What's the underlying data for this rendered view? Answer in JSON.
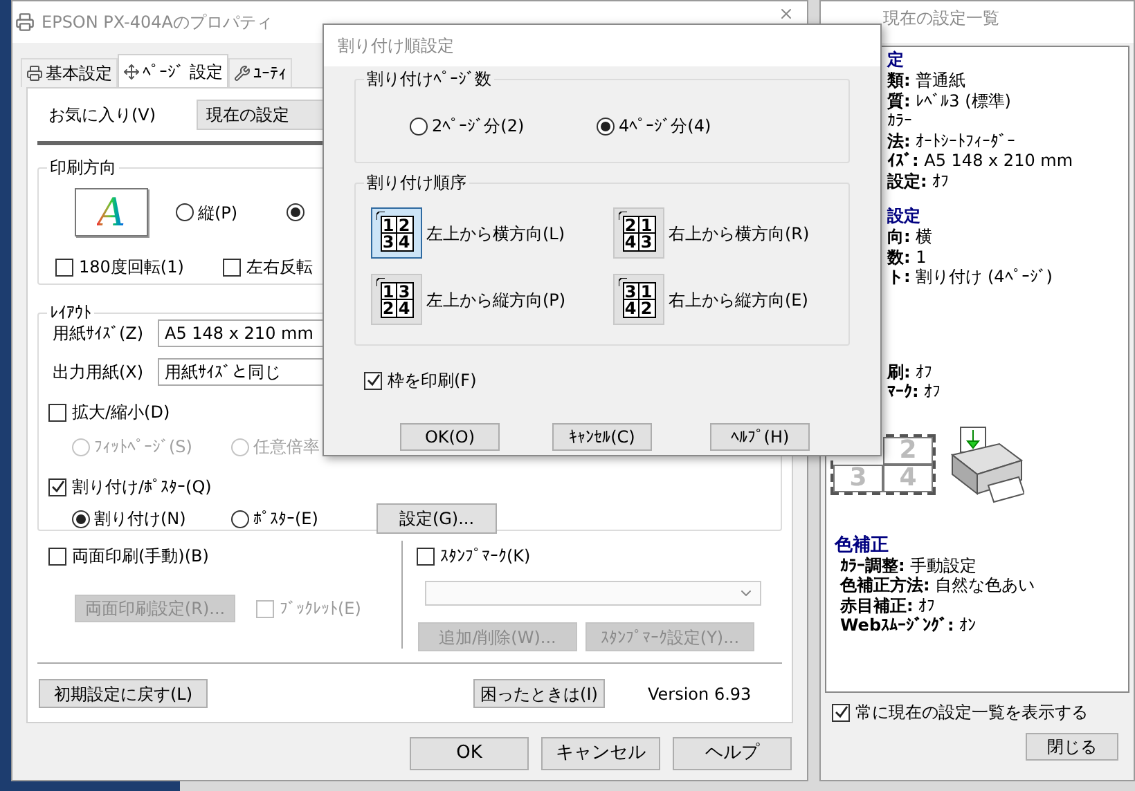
{
  "main_window": {
    "title": "EPSON PX-404Aのプロパティ",
    "tabs": [
      {
        "label": "基本設定",
        "selected": false
      },
      {
        "label": "ﾍﾟｰｼﾞ 設定",
        "selected": true
      },
      {
        "label": "ﾕｰﾃｨ",
        "selected": false
      }
    ],
    "favorites": {
      "label": "お気に入り(V)",
      "value": "現在の設定"
    },
    "orientation": {
      "title": "印刷方向",
      "preview_letter": "A",
      "options": [
        {
          "label": "縦(P)",
          "selected": false
        },
        {
          "selected": true
        }
      ],
      "checkboxes": [
        {
          "label": "180度回転(1)",
          "checked": false
        },
        {
          "label": "左右反転",
          "checked": false
        }
      ]
    },
    "layout": {
      "title": "ﾚｲｱｳﾄ",
      "paper_size": {
        "label": "用紙ｻｲｽﾞ(Z)",
        "value": "A5 148 x 210 mm"
      },
      "output_paper": {
        "label": "出力用紙(X)",
        "value": "用紙ｻｲｽﾞと同じ"
      },
      "scale": {
        "label": "拡大/縮小(D)",
        "checked": false,
        "options": [
          {
            "label": "ﾌｨｯﾄﾍﾟｰｼﾞ(S)",
            "selected": false
          },
          {
            "label": "任意倍率",
            "selected": false
          }
        ]
      },
      "multipage": {
        "label": "割り付け/ﾎﾟｽﾀｰ(Q)",
        "checked": true,
        "options": [
          {
            "label": "割り付け(N)",
            "selected": true
          },
          {
            "label": "ﾎﾟｽﾀｰ(E)",
            "selected": false
          }
        ],
        "button": "設定(G)..."
      }
    },
    "duplex": {
      "label": "両面印刷(手動)(B)",
      "checked": false,
      "button": "両面印刷設定(R)...",
      "booklet": {
        "label": "ﾌﾞｯｸﾚｯﾄ(E)",
        "checked": false
      }
    },
    "stamp": {
      "label": "ｽﾀﾝﾌﾟﾏｰｸ(K)",
      "checked": false,
      "buttons": [
        "追加/削除(W)...",
        "ｽﾀﾝﾌﾟﾏｰｸ設定(Y)..."
      ]
    },
    "reset_button": "初期設定に戻す(L)",
    "trouble_button": "困ったときは(I)",
    "version": "Version 6.93",
    "buttons": [
      "OK",
      "キャンセル",
      "ヘルプ"
    ]
  },
  "dialog": {
    "title": "割り付け順設定",
    "page_count": {
      "title": "割り付けﾍﾟｰｼﾞ数",
      "options": [
        {
          "label": "2ﾍﾟｰｼﾞ分(2)",
          "selected": false
        },
        {
          "label": "4ﾍﾟｰｼﾞ分(4)",
          "selected": true
        }
      ]
    },
    "order": {
      "title": "割り付け順序",
      "options": [
        {
          "label": "左上から横方向(L)",
          "pages": [
            "1",
            "2",
            "3",
            "4"
          ],
          "selected": true
        },
        {
          "label": "右上から横方向(R)",
          "pages": [
            "2",
            "1",
            "4",
            "3"
          ],
          "selected": false
        },
        {
          "label": "左上から縦方向(P)",
          "pages": [
            "1",
            "3",
            "2",
            "4"
          ],
          "selected": false
        },
        {
          "label": "右上から縦方向(E)",
          "pages": [
            "3",
            "1",
            "4",
            "2"
          ],
          "selected": false
        }
      ]
    },
    "print_frame": {
      "label": "枠を印刷(F)",
      "checked": true
    },
    "buttons": [
      "OK(O)",
      "ｷｬﾝｾﾙ(C)",
      "ﾍﾙﾌﾟ(H)"
    ]
  },
  "settings_window": {
    "title": "現在の設定一覧",
    "sections": [
      {
        "title": "定",
        "items": [
          {
            "label": "類:",
            "value": "普通紙"
          },
          {
            "label": "質:",
            "value": "ﾚﾍﾞﾙ3 (標準)"
          },
          {
            "value": "ｶﾗｰ"
          },
          {
            "label": "法:",
            "value": "ｵｰﾄｼｰﾄﾌｨｰﾀﾞｰ"
          },
          {
            "label": "ｲｽﾞ:",
            "value": "A5 148 x 210 mm"
          },
          {
            "label": "設定:",
            "value": "ｵﾌ"
          }
        ]
      },
      {
        "title": "設定",
        "items": [
          {
            "label": "向:",
            "value": "横"
          },
          {
            "label": "数:",
            "value": "1"
          },
          {
            "label": "ト:",
            "value": "割り付け (4ﾍﾟｰｼﾞ)"
          }
        ]
      },
      {
        "items": [
          {
            "label": "刷:",
            "value": "ｵﾌ"
          },
          {
            "label": "ﾏｰｸ:",
            "value": "ｵﾌ"
          }
        ]
      }
    ],
    "preview_pages": [
      "2",
      "3",
      "4"
    ],
    "color_section": {
      "title": "色補正",
      "items": [
        {
          "label": "ｶﾗｰ調整:",
          "value": "手動設定"
        },
        {
          "label": "色補正方法:",
          "value": "自然な色あい"
        },
        {
          "label": "赤目補正:",
          "value": "ｵﾌ"
        },
        {
          "label": "Webｽﾑｰｼﾞﾝｸﾞ:",
          "value": "ｵﾝ"
        }
      ]
    },
    "always_show": {
      "label": "常に現在の設定一覧を表示する",
      "checked": true
    },
    "close_button": "閉じる"
  }
}
